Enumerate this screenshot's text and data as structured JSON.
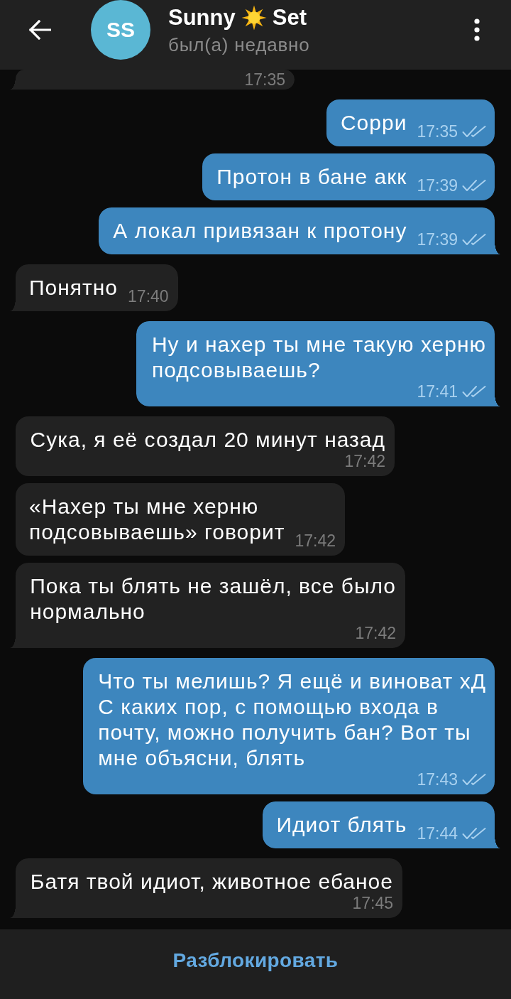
{
  "header": {
    "title": [
      {
        "kind": "text",
        "text": "Sunny"
      },
      {
        "kind": "emoji"
      },
      {
        "kind": "text",
        "text": "Set"
      }
    ],
    "avatar_initials": "SS",
    "status": "был(а) недавно"
  },
  "messages": [
    {
      "outgoing": false,
      "time": "17:35"
    },
    {
      "outgoing": true,
      "text": "Сорри",
      "time": "17:35",
      "read": true
    },
    {
      "outgoing": true,
      "text": "Протон в бане акк",
      "time": "17:39",
      "read": true
    },
    {
      "outgoing": true,
      "text": "А локал привязан к протону",
      "time": "17:39",
      "read": true
    },
    {
      "outgoing": false,
      "text": "Понятно",
      "time": "17:40"
    },
    {
      "outgoing": true,
      "text": "Ну и нахер ты мне такую херню\nподсовываешь?",
      "time": "17:41",
      "read": true
    },
    {
      "outgoing": false,
      "text": "Сука, я её создал 20 минут назад",
      "time": "17:42"
    },
    {
      "outgoing": false,
      "text": "«Нахер ты мне херню\nподсовываешь» говорит",
      "time": "17:42"
    },
    {
      "outgoing": false,
      "text": "Пока ты блять не зашёл, все было\nнормально",
      "time": "17:42"
    },
    {
      "outgoing": true,
      "text": "Что ты мелишь? Я ещё и виноват хД\nС каких пор, с помощью входа в\nпочту, можно получить бан? Вот ты\nмне объясни, блять",
      "time": "17:43",
      "read": true
    },
    {
      "outgoing": true,
      "text": "Идиот блять",
      "time": "17:44",
      "read": true
    },
    {
      "outgoing": false,
      "text": "Батя твой идиот, животное ебаное",
      "time": "17:45"
    }
  ],
  "bottom_bar": {
    "button": "Разблокировать"
  }
}
